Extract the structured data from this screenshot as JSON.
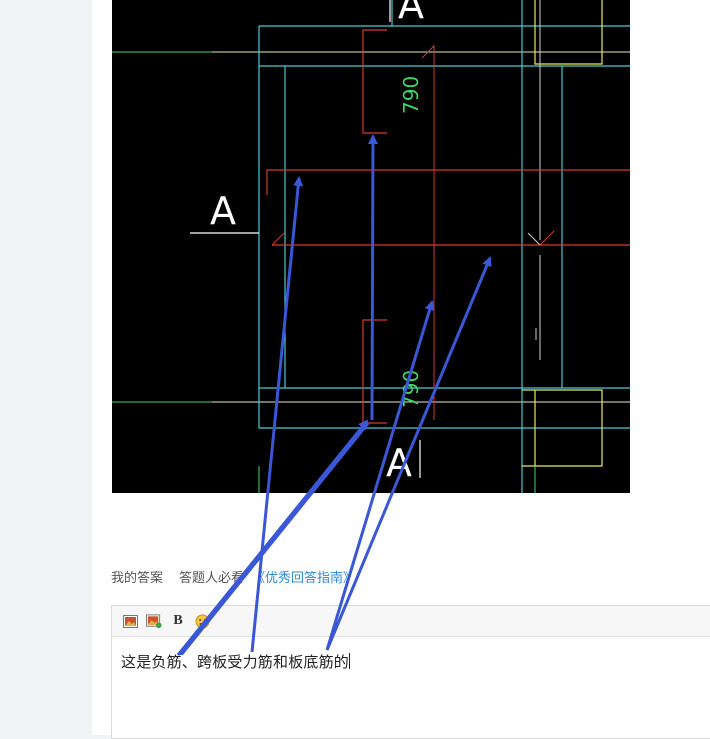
{
  "drawing": {
    "section_marks": [
      "A",
      "A",
      "A"
    ],
    "dimensions": [
      "790",
      "790"
    ],
    "colors": {
      "background": "#000000",
      "cyan_lines": "#48c9d8",
      "red_lines": "#d53a2e",
      "yellow_lines": "#e8e85a",
      "green_text": "#3fd46a",
      "annotation_arrows": "#3a57d6"
    }
  },
  "answer_nav": {
    "my_answer": "我的答案",
    "must_read": "答题人必看",
    "guide_link": "《优秀回答指南》"
  },
  "editor": {
    "toolbar": {
      "image_icon": "image-icon",
      "gallery_icon": "image-library-icon",
      "bold_label": "B",
      "emoji_icon": "emoji-icon"
    },
    "text": "这是负筋、跨板受力筋和板底筋的"
  }
}
